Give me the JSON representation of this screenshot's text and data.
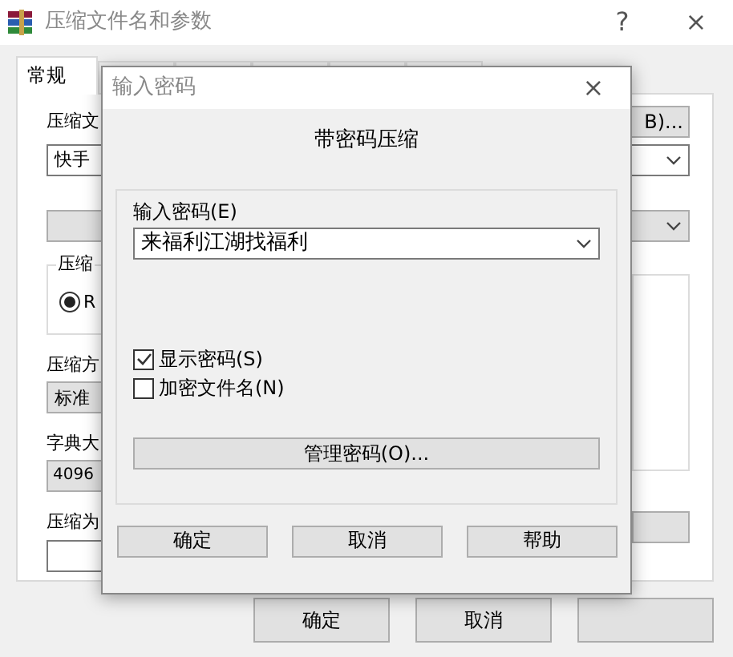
{
  "window": {
    "title": "压缩文件名和参数",
    "help": "?",
    "close": "×"
  },
  "tabs": [
    {
      "label": "常规",
      "selected": true
    },
    {
      "selected": false
    },
    {
      "selected": false
    },
    {
      "selected": false
    },
    {
      "selected": false
    },
    {
      "selected": false
    }
  ],
  "general": {
    "archive_label": "压缩文",
    "browse_button": "B)...",
    "archive_name": "快手",
    "format_group": {
      "label": "压缩",
      "radio": {
        "label": "R",
        "selected": true
      }
    },
    "method": {
      "label": "压缩方",
      "value": "标准"
    },
    "dictionary": {
      "label": "字典大",
      "value": "4096"
    },
    "split": {
      "label": "压缩为"
    }
  },
  "buttons": [
    "确定",
    "取消"
  ],
  "password_dialog": {
    "title": "输入密码",
    "close": "×",
    "heading": "带密码压缩",
    "password_label": "输入密码(E)",
    "password": "来福利江湖找福利",
    "options": [
      {
        "label": "显示密码(S)",
        "checked": true
      },
      {
        "label": "加密文件名(N)",
        "checked": false
      }
    ],
    "manage_button": "管理密码(O)...",
    "buttons": [
      "确定",
      "取消",
      "帮助"
    ]
  }
}
